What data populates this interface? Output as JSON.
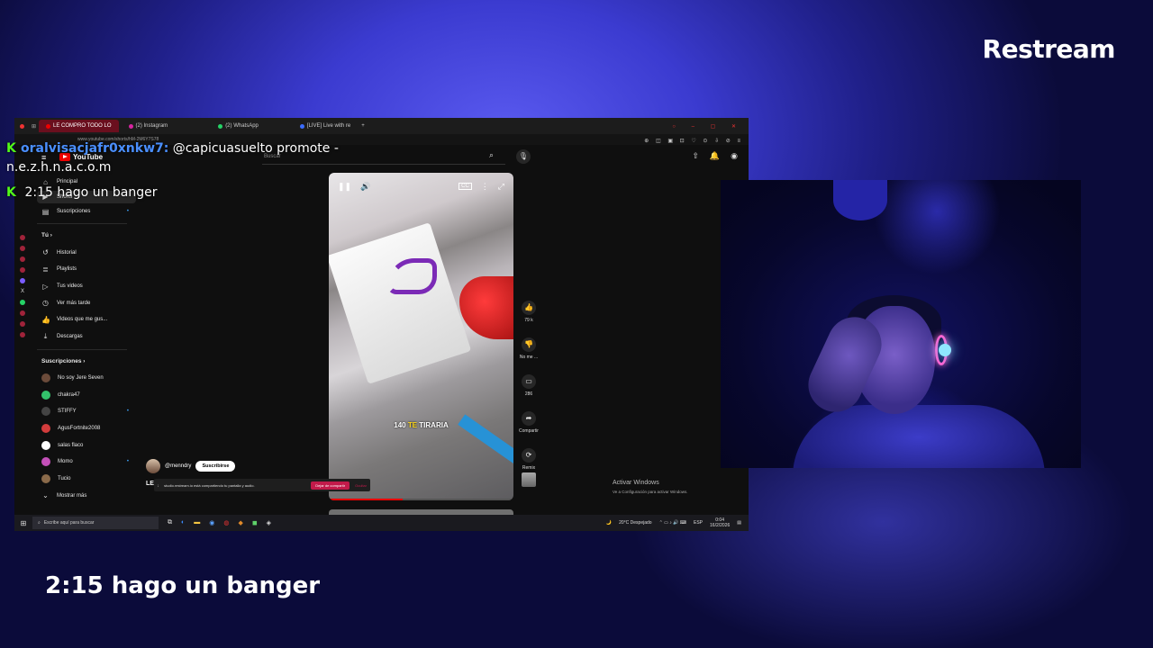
{
  "brand": "Restream",
  "caption": "2:15 hago un banger",
  "chat": [
    {
      "icon": "kick-icon",
      "user": "oralvisacjafr0xnkw7:",
      "message": " @capicuasuelto promote - n.e.z.h.n.a.c.o.m"
    },
    {
      "icon": "kick-icon",
      "user": "",
      "message": "2:15 hago un banger"
    }
  ],
  "browser": {
    "tabs": [
      "LE COMPRO TODO LO",
      "(2) Instagram",
      "(2) WhatsApp",
      "[LIVE] Live with re"
    ],
    "url": "www.youtube.com/shorts/hM-2M6Y7S78"
  },
  "youtube": {
    "logo_text": "YouTube",
    "search_placeholder": "Buscar",
    "sidebar": {
      "main": [
        {
          "icon": "home-icon",
          "label": "Principal"
        },
        {
          "icon": "shorts-icon",
          "label": "Shorts"
        },
        {
          "icon": "subscriptions-icon",
          "label": "Suscripciones"
        }
      ],
      "you_heading": "Tú",
      "you": [
        {
          "icon": "history-icon",
          "label": "Historial"
        },
        {
          "icon": "playlist-icon",
          "label": "Playlists"
        },
        {
          "icon": "video-icon",
          "label": "Tus videos"
        },
        {
          "icon": "clock-icon",
          "label": "Ver más tarde"
        },
        {
          "icon": "thumbs-up-icon",
          "label": "Videos que me gus..."
        },
        {
          "icon": "download-icon",
          "label": "Descargas"
        }
      ],
      "subs_heading": "Suscripciones",
      "subs": [
        {
          "label": "No soy Jere Seven",
          "color": "#6b4b3a"
        },
        {
          "label": "chakra47",
          "color": "#33c26b"
        },
        {
          "label": "STIFFY",
          "color": "#444444"
        },
        {
          "label": "AgusFortnite2008",
          "color": "#d23c3c"
        },
        {
          "label": "salas flaco",
          "color": "#ffffff"
        },
        {
          "label": "Momo",
          "color": "#c34fb8"
        },
        {
          "label": "Tucio",
          "color": "#8a6a4a"
        }
      ],
      "show_more": "Mostrar más"
    },
    "video": {
      "subtitle_a": "140 ",
      "subtitle_b": "TE",
      "subtitle_c": " TIRARIA"
    },
    "actions": {
      "likes": "79 k",
      "dislike": "No me ...",
      "comments": "286",
      "share": "Compartir",
      "remix": "Remix"
    },
    "channel": "@menndry",
    "subscribe": "Suscribirse",
    "title_prefix": "LE"
  },
  "share_notice": {
    "text": "studio.restream.io está compartiendo tu pantalla y audio.",
    "stop": "Dejar de compartir",
    "hide": "Ocultar"
  },
  "windows": {
    "activate": "Activar Windows",
    "activate_sub": "Ve a Configuración para activar Windows.",
    "search": "Escribe aquí para buscar",
    "weather": "20°C Despejado",
    "lang": "ESP",
    "time": "0:04",
    "date": "16/2/2026"
  }
}
